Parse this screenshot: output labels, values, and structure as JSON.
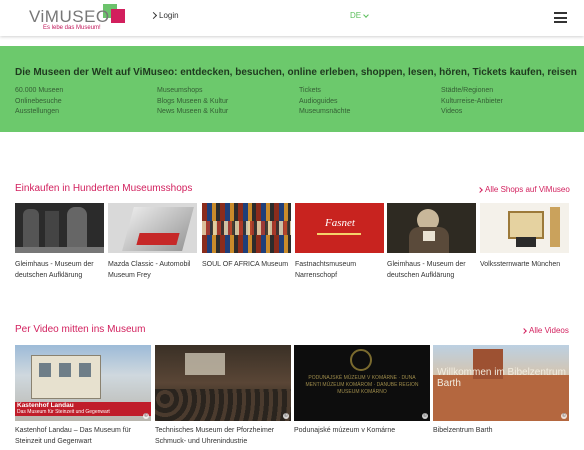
{
  "header": {
    "logo_text": "ViMUSEO",
    "logo_tagline": "Es lebe das Museum!",
    "login_label": "Login",
    "language": "DE",
    "menu_icon": "hamburger-menu-icon"
  },
  "banner": {
    "title": "Die Museen der Welt auf ViMuseo: entdecken, besuchen, online erleben, shoppen, lesen, hören, Tickets kaufen, reisen",
    "columns": [
      [
        "60.000 Museen",
        "Onlinebesuche",
        "Ausstellungen"
      ],
      [
        "Museumshops",
        "Blogs Museen & Kultur",
        "News Museen & Kultur"
      ],
      [
        "Tickets",
        "Audioguides",
        "Museumsnächte"
      ],
      [
        "Städte/Regionen",
        "Kulturreise-Anbieter",
        "Videos"
      ]
    ]
  },
  "shops_section": {
    "title": "Einkaufen in Hunderten Museumsshops",
    "more_label": "Alle Shops auf ViMuseo",
    "items": [
      {
        "caption": "Gleimhaus - Museum der deutschen Aufklärung"
      },
      {
        "caption": "Mazda Classic - Automobil Museum Frey"
      },
      {
        "caption": "SOUL OF AFRICA Museum"
      },
      {
        "caption": "Fastnachtsmuseum Narrenschopf",
        "image_text": "Fasnet"
      },
      {
        "caption": "Gleimhaus - Museum der deutschen Aufklärung"
      },
      {
        "caption": "Volkssternwarte München"
      }
    ]
  },
  "video_section": {
    "title": "Per Video mitten ins Museum",
    "more_label": "Alle Videos",
    "items": [
      {
        "caption": "Kastenhof Landau – Das Museum für Steinzeit und Gegenwart",
        "image_text": "Kastenhof Landau",
        "image_subtext": "Das Museum für Steinzeit und Gegenwart"
      },
      {
        "caption": "Technisches Museum der Pforzheimer Schmuck- und Uhrenindustrie"
      },
      {
        "caption": "Podunajské múzeum v Komárne",
        "image_text": "PODUNAJSKÉ MÚZEUM V KOMÁRNE · DUNA MENTI MÚZEUM KOMÁROM · DANUBE REGION MUSEUM KOMÁRNO"
      },
      {
        "caption": "Bibelzentrum Barth",
        "image_text": "Willkommen im Bibelzentrum Barth"
      }
    ]
  }
}
